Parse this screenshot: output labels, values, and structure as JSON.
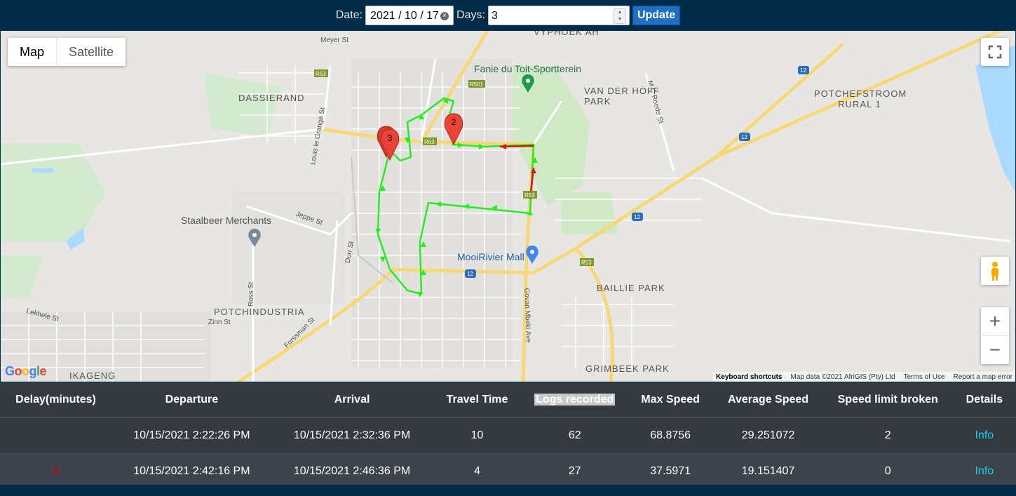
{
  "toolbar": {
    "date_label": "Date:",
    "date_value": "2021 / 10 / 17",
    "days_label": "Days:",
    "days_value": "3",
    "update_label": "Update"
  },
  "map": {
    "type_buttons": [
      "Map",
      "Satellite"
    ],
    "active_type": "Map",
    "area_labels": [
      "DASSIERAND",
      "VAN DER HOFF PARK",
      "POTCHEFSTROOM RURAL 1",
      "POTCHINDUSTRIA",
      "BAILLIE PARK",
      "GRIMBEEK PARK",
      "IKAGENG",
      "VYPHOEK AH"
    ],
    "streets": [
      "Meyer St",
      "Louis le Grange St",
      "Jeppe St",
      "Durr St",
      "Ross St",
      "Zinn St",
      "Lekhele St",
      "Forssman St",
      "Govan Mbeki Ave",
      "M C Roode St"
    ],
    "road_badges": [
      "R53",
      "R501",
      "12"
    ],
    "pois": [
      "Fanie du Toit-Sportterein",
      "Staalbeer Merchants",
      "MooiRivier Mall"
    ],
    "markers": [
      "2",
      "3"
    ],
    "zoom_in": "+",
    "zoom_out": "−",
    "logo": "Google",
    "attribution": [
      "Keyboard shortcuts",
      "Map data ©2021 AfriGIS (Pty) Ltd",
      "Terms of Use",
      "Report a map error"
    ],
    "colors": {
      "route": "#22ee22",
      "route_alert": "#e01010",
      "marker": "#ea4335"
    }
  },
  "table": {
    "headers": [
      "Delay(minutes)",
      "Departure",
      "Arrival",
      "Travel Time",
      "Logs recorded",
      "Max Speed",
      "Average Speed",
      "Speed limit broken",
      "Details"
    ],
    "rows": [
      [
        "",
        "10/15/2021 2:22:26 PM",
        "10/15/2021 2:32:36 PM",
        "10",
        "62",
        "68.8756",
        "29.251072",
        "2",
        "Info"
      ],
      [
        "9",
        "10/15/2021 2:42:16 PM",
        "10/15/2021 2:46:36 PM",
        "4",
        "27",
        "37.5971",
        "19.151407",
        "0",
        "Info"
      ]
    ]
  }
}
